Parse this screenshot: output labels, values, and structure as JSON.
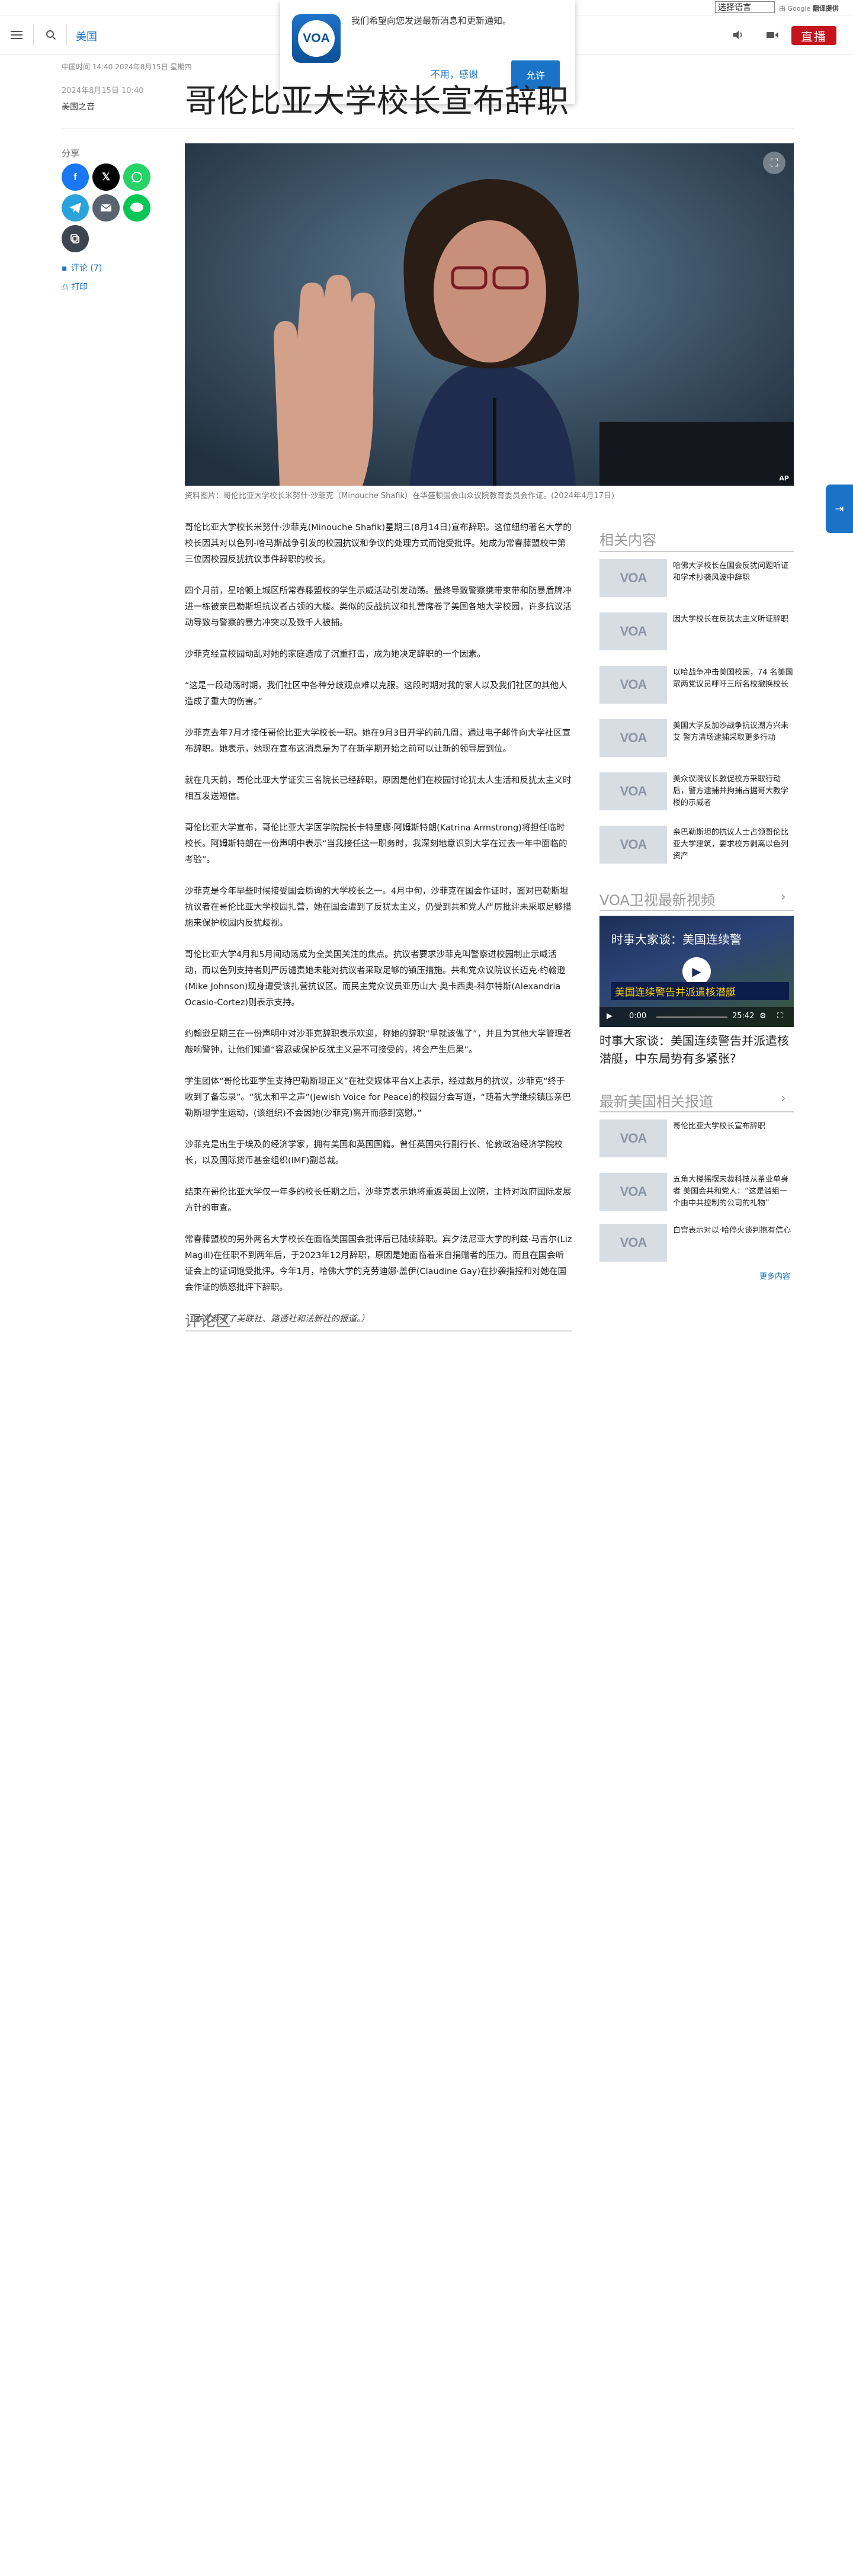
{
  "utility": {
    "language_select": "选择语言",
    "google_label": "由 Google",
    "translate_label": "翻译提供"
  },
  "header": {
    "section": "美国",
    "live_label": "直播"
  },
  "notification": {
    "message": "我们希望向您发送最新消息和更新通知。",
    "deny_label": "不用，感谢",
    "allow_label": "允许",
    "logo_text": "VOA"
  },
  "article": {
    "timestamp": "中国时间 14:40 2024年8月15日 星期四",
    "pub_date": "2024年8月15日 10:40",
    "byline": "美国之音",
    "headline": "哥伦比亚大学校长宣布辞职",
    "share_label": "分享",
    "comments_link": "评论 (7)",
    "print_link": "打印",
    "caption": "资料图片：哥伦比亚大学校长米努什·沙菲克（Minouche Shafik）在华盛顿国会山众议院教育委员会作证。(2024年4月17日)",
    "photo_credit": "AP",
    "paragraphs": [
      "哥伦比亚大学校长米努什·沙菲克(Minouche Shafik)星期三(8月14日)宣布辞职。这位纽约著名大学的校长因其对以色列-哈马斯战争引发的校园抗议和争议的处理方式而饱受批评。她成为常春藤盟校中第三位因校园反犹抗议事件辞职的校长。",
      "四个月前，星哈顿上城区所常春藤盟校的学生示威活动引发动荡。最终导致警察携带束带和防暴盾牌冲进一栋被亲巴勒斯坦抗议者占领的大楼。类似的反战抗议和扎营席卷了美国各地大学校园，许多抗议活动导致与警察的暴力冲突以及数千人被捕。",
      "沙菲克经宣校园动乱对她的家庭造成了沉重打击，成为她决定辞职的一个因素。",
      "“这是一段动荡时期，我们社区中各种分歧观点难以克服。这段时期对我的家人以及我们社区的其他人造成了重大的伤害。”",
      "沙菲克去年7月才接任哥伦比亚大学校长一职。她在9月3日开学的前几周，通过电子邮件向大学社区宣布辞职。她表示，她现在宣布这消息是为了在新学期开始之前可以让新的领导层到位。",
      "就在几天前，哥伦比亚大学证实三名院长已经辞职，原因是他们在校园讨论犹太人生活和反犹太主义时相互发送短信。",
      "哥伦比亚大学宣布，哥伦比亚大学医学院院长卡特里娜·阿姆斯特朗(Katrina Armstrong)将担任临时校长。阿姆斯特朗在一份声明中表示“当我接任这一职务时，我深刻地意识到大学在过去一年中面临的考验”。",
      "沙菲克是今年早些时候接受国会质询的大学校长之一。4月中旬，沙菲克在国会作证时，面对巴勒斯坦抗议者在哥伦比亚大学校园扎营，她在国会遭到了反犹太主义，仍受到共和党人严厉批评未采取足够措施来保护校园内反犹歧视。",
      "哥伦比亚大学4月和5月间动荡成为全美国关注的焦点。抗议者要求沙菲克叫警察进校园制止示威活动，而以色列支持者则严厉谴责她未能对抗议者采取足够的镇压措施。共和党众议院议长迈克·约翰逊(Mike Johnson)现身遭受该扎营抗议区。而民主党众议员亚历山大·奥卡西奥-科尔特斯(Alexandria Ocasio-Cortez)则表示支持。",
      "约翰逊星期三在一份声明中对沙菲克辞职表示欢迎，称她的辞职“早就该做了”，并且为其他大学管理者敲响警钟，让他们知道“容忍或保护反犹主义是不可接受的，将会产生后果”。",
      "学生团体“哥伦比亚学生支持巴勒斯坦正义”在社交媒体平台X上表示，经过数月的抗议，沙菲克“终于收到了备忘录”。“犹太和平之声”(Jewish Voice for Peace)的校园分会写道，“随着大学继续镇压亲巴勒斯坦学生运动，(该组织)不会因她(沙菲克)离开而感到宽慰。”",
      "沙菲克是出生于埃及的经济学家，拥有美国和英国国籍。曾任英国央行副行长、伦敦政治经济学院校长，以及国际货币基金组织(IMF)副总裁。",
      "结束在哥伦比亚大学仅一年多的校长任期之后，沙菲克表示她将重返英国上议院，主持对政府国际发展方针的审查。",
      "常春藤盟校的另外两名大学校长在面临美国国会批评后已陆续辞职。宾夕法尼亚大学的利兹·马吉尔(Liz Magill)在任职不到两年后，于2023年12月辞职，原因是她面临着来自捐赠者的压力。而且在国会听证会上的证词饱受批评。今年1月，哈佛大学的克劳迪娜·盖伊(Claudine Gay)在抄袭指控和对她在国会作证的愤怒批评下辞职。"
    ],
    "credit_line": "（本文参考了美联社、路透社和法新社的报道。）",
    "comments_title": "评论区"
  },
  "sidebar": {
    "related_title": "相关内容",
    "related": [
      "哈佛大学校长在国会反犹问题听证和学术抄袭风波中辞职",
      "因大学校长在反犹太主义听证辞职",
      "以哈战争冲击美国校园，74 名美国眾两党议员呼吁三所名校撤换校长",
      "美国大学反加沙战争抗议潮方兴未艾 警方清场逮捕采取更多行动",
      "美众议院议长敦促校方采取行动后，警方逮捕并拘捕占据哥大教学楼的示威者",
      "亲巴勒斯坦的抗议人士占领哥伦比亚大学建筑，要求校方剥离以色列资产"
    ],
    "video_title": "VOA卫视最新视频",
    "video_overlay_title": "时事大家谈：美国连续警",
    "video_banner": "美国连续警告并派遣核潜艇",
    "video_time_current": "0:00",
    "video_time_total": "25:42",
    "video_caption": "时事大家谈：美国连续警告并派遣核潜艇，中东局势有多紧张?",
    "latest_title": "最新美国相关报道",
    "latest": [
      "哥伦比亚大学校长宣布辞职",
      "五角大楼摇摆未裁科技从茶业单身者 美国会共和党人：“这是滥组一个由中共控制的公司的礼物”",
      "白宫表示对以·哈停火谈判抱有信心"
    ],
    "more_label": "更多内容"
  }
}
